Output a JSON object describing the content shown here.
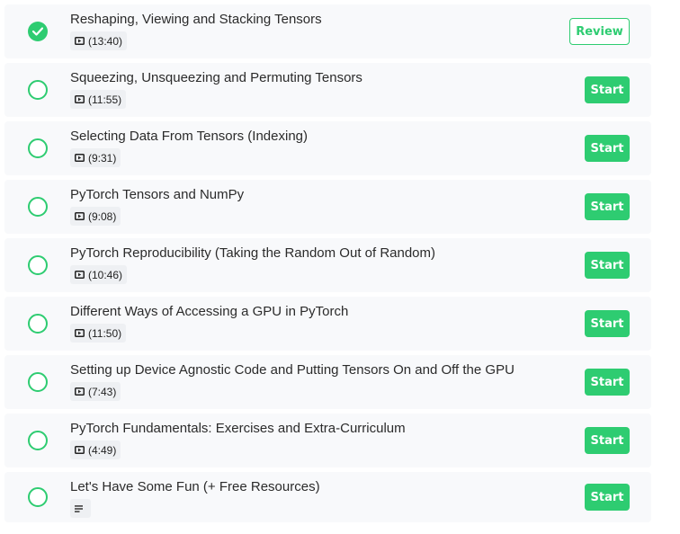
{
  "colors": {
    "accent": "#2ecc71",
    "row_bg": "#f8f9fb",
    "meta_bg": "#eef0f3"
  },
  "lessons": [
    {
      "title": "Reshaping, Viewing and Stacking Tensors",
      "duration": "(13:40)",
      "status": "completed",
      "type": "video",
      "icon": "video-icon",
      "action": "Review"
    },
    {
      "title": "Squeezing, Unsqueezing and Permuting Tensors",
      "duration": "(11:55)",
      "status": "not-started",
      "type": "video",
      "icon": "video-icon",
      "action": "Start"
    },
    {
      "title": "Selecting Data From Tensors (Indexing)",
      "duration": "(9:31)",
      "status": "not-started",
      "type": "video",
      "icon": "video-icon",
      "action": "Start"
    },
    {
      "title": "PyTorch Tensors and NumPy",
      "duration": "(9:08)",
      "status": "not-started",
      "type": "video",
      "icon": "video-icon",
      "action": "Start"
    },
    {
      "title": "PyTorch Reproducibility (Taking the Random Out of Random)",
      "duration": "(10:46)",
      "status": "not-started",
      "type": "video",
      "icon": "video-icon",
      "action": "Start"
    },
    {
      "title": "Different Ways of Accessing a GPU in PyTorch",
      "duration": "(11:50)",
      "status": "not-started",
      "type": "video",
      "icon": "video-icon",
      "action": "Start"
    },
    {
      "title": "Setting up Device Agnostic Code and Putting Tensors On and Off the GPU",
      "duration": "(7:43)",
      "status": "not-started",
      "type": "video",
      "icon": "video-icon",
      "action": "Start"
    },
    {
      "title": "PyTorch Fundamentals: Exercises and Extra-Curriculum",
      "duration": "(4:49)",
      "status": "not-started",
      "type": "video",
      "icon": "video-icon",
      "action": "Start"
    },
    {
      "title": "Let's Have Some Fun (+ Free Resources)",
      "duration": "",
      "status": "not-started",
      "type": "text",
      "icon": "text-document-icon",
      "action": "Start"
    }
  ]
}
